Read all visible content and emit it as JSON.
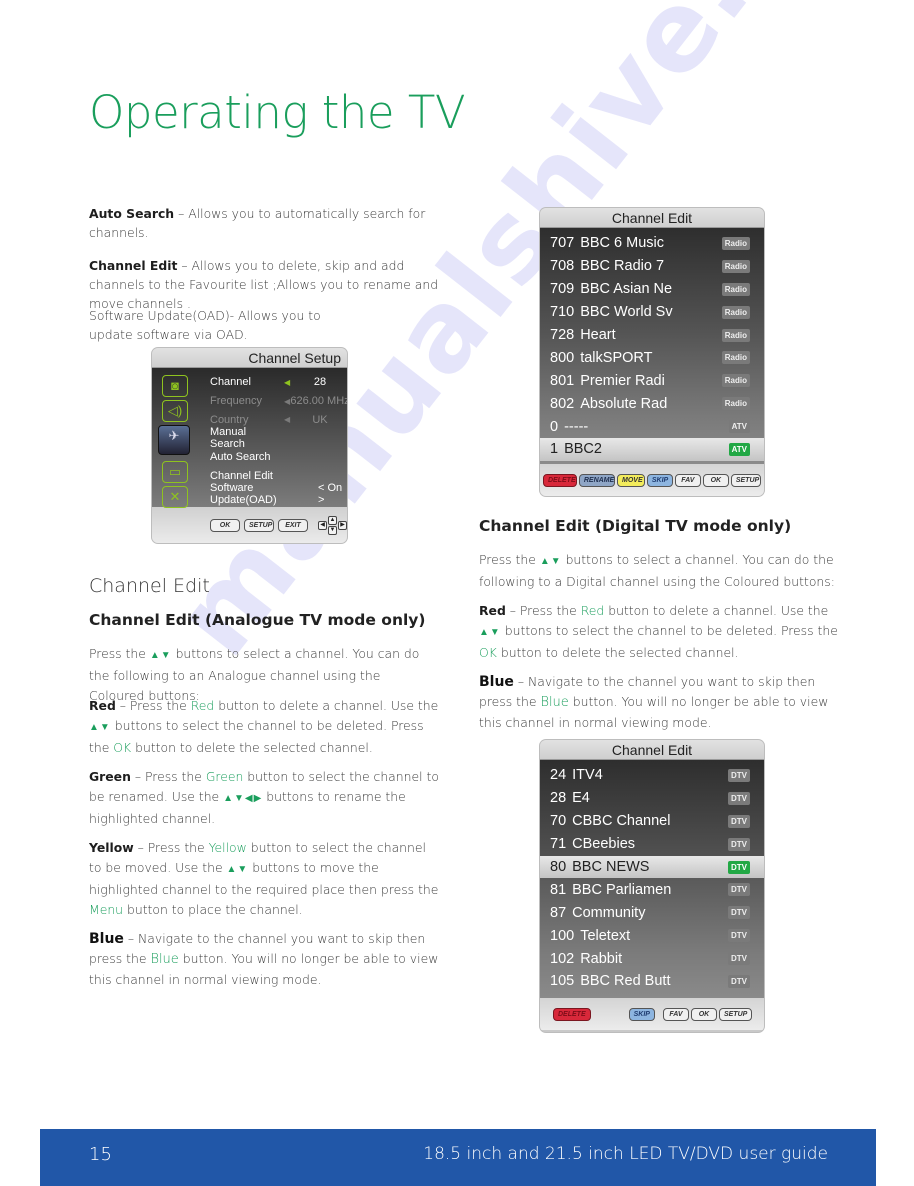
{
  "page": {
    "title": "Operating the TV",
    "watermark": "manualshive.com",
    "colors": {
      "accent_green": "#1a9e5c",
      "footer_blue": "#2157a8",
      "badge_active": "#22a845"
    }
  },
  "intro": {
    "auto_search": {
      "term": "Auto Search",
      "text": " – Allows you to automatically search for channels."
    },
    "channel_edit": {
      "term": "Channel Edit",
      "text": " – Allows you to delete, skip and add channels to the Favourite list ;Allows you to rename and move channels ."
    },
    "software_update": "Software Update(OAD)- Allows you to update software via OAD."
  },
  "channel_setup_menu": {
    "title": "Channel Setup",
    "side_icons": [
      "picture-icon",
      "sound-icon",
      "channel-satellite-icon",
      "screen-icon",
      "tools-icon"
    ],
    "items": [
      {
        "label": "Channel",
        "value": "28",
        "dim": false
      },
      {
        "label": "Frequency",
        "value": "626.00 MHz",
        "dim": true
      },
      {
        "label": "Country",
        "value": "UK",
        "dim": true
      },
      {
        "label": "Manual Search",
        "value": "",
        "dim": false
      },
      {
        "label": "Auto Search",
        "value": "",
        "dim": false
      },
      {
        "label": "Channel Edit",
        "value": "",
        "dim": false
      },
      {
        "label": "Software Update(OAD)",
        "value": "< On >",
        "dim": false
      }
    ],
    "footer_buttons": [
      "OK",
      "SETUP",
      "EXIT"
    ]
  },
  "section": {
    "title": "Channel Edit",
    "analogue": {
      "heading": "Channel Edit (Analogue TV mode only)",
      "intro_a": "Press the ",
      "arrows_ud": "▲▼",
      "intro_b": " buttons to select a channel. You can do the following to an Analogue channel using the Coloured buttons:",
      "red": {
        "term": "Red",
        "a": " – Press the ",
        "key": "Red",
        "b": " button to delete a channel. Use the ",
        "c": " buttons to select the channel to be deleted. Press the ",
        "ok": "OK",
        "d": " button to delete the selected channel."
      },
      "green": {
        "term": "Green",
        "a": " – Press the ",
        "key": "Green",
        "b": " button to select the channel to be renamed. Use the ",
        "arrows": "▲▼◀▶",
        "c": " buttons to rename the highlighted channel."
      },
      "yellow": {
        "term": "Yellow",
        "a": " – Press the ",
        "key": "Yellow",
        "b": " button to select the channel to be moved. Use the ",
        "c": " buttons to move the highlighted channel to the required place then press the ",
        "menu": "Menu",
        "d": " button to place the channel."
      },
      "blue": {
        "term": "Blue",
        "a": " – Navigate to the channel you want to skip then press the ",
        "key": "Blue",
        "b": " button. You will no longer be able to view this channel in normal viewing mode."
      }
    },
    "digital": {
      "heading": "Channel Edit (Digital TV mode only)",
      "intro_a": "Press the ",
      "intro_b": " buttons to select a channel. You can do the following to a Digital channel using the Coloured buttons:",
      "red": {
        "term": "Red",
        "a": " – Press the ",
        "key": "Red",
        "b": " button to delete a channel. Use the ",
        "c": " buttons to select the channel to be deleted. Press the ",
        "ok": "OK",
        "d": " button to delete the selected channel."
      },
      "blue": {
        "term": "Blue",
        "a": " – Navigate to the channel you want to skip then press the ",
        "key": "Blue",
        "b": " button. You will no longer be able to view this channel in normal viewing mode."
      }
    }
  },
  "channel_edit_radio": {
    "title": "Channel Edit",
    "rows": [
      {
        "num": "707",
        "name": "BBC 6 Music",
        "badge": "Radio",
        "selected": false
      },
      {
        "num": "708",
        "name": "BBC Radio 7",
        "badge": "Radio",
        "selected": false
      },
      {
        "num": "709",
        "name": "BBC Asian Ne",
        "badge": "Radio",
        "selected": false
      },
      {
        "num": "710",
        "name": "BBC World Sv",
        "badge": "Radio",
        "selected": false
      },
      {
        "num": "728",
        "name": "Heart",
        "badge": "Radio",
        "selected": false
      },
      {
        "num": "800",
        "name": "talkSPORT",
        "badge": "Radio",
        "selected": false
      },
      {
        "num": "801",
        "name": "Premier Radi",
        "badge": "Radio",
        "selected": false
      },
      {
        "num": "802",
        "name": "Absolute Rad",
        "badge": "Radio",
        "selected": false
      },
      {
        "num": "0",
        "name": "-----",
        "badge": "ATV",
        "selected": false
      },
      {
        "num": "1",
        "name": "BBC2",
        "badge": "ATV",
        "selected": true
      }
    ],
    "buttons": [
      "DELETE",
      "RENAME",
      "MOVE",
      "SKIP",
      "FAV",
      "OK",
      "SETUP"
    ]
  },
  "channel_edit_dtv": {
    "title": "Channel Edit",
    "rows": [
      {
        "num": "24",
        "name": "ITV4",
        "badge": "DTV",
        "selected": false
      },
      {
        "num": "28",
        "name": "E4",
        "badge": "DTV",
        "selected": false
      },
      {
        "num": "70",
        "name": "CBBC Channel",
        "badge": "DTV",
        "selected": false
      },
      {
        "num": "71",
        "name": "CBeebies",
        "badge": "DTV",
        "selected": false
      },
      {
        "num": "80",
        "name": "BBC NEWS",
        "badge": "DTV",
        "selected": true
      },
      {
        "num": "81",
        "name": "BBC Parliamen",
        "badge": "DTV",
        "selected": false
      },
      {
        "num": "87",
        "name": "Community",
        "badge": "DTV",
        "selected": false
      },
      {
        "num": "100",
        "name": "Teletext",
        "badge": "DTV",
        "selected": false
      },
      {
        "num": "102",
        "name": "Rabbit",
        "badge": "DTV",
        "selected": false
      },
      {
        "num": "105",
        "name": "BBC Red Butt",
        "badge": "DTV",
        "selected": false
      }
    ],
    "buttons": [
      "DELETE",
      "SKIP",
      "FAV",
      "OK",
      "SETUP"
    ]
  },
  "footer": {
    "page_number": "15",
    "guide_title": "18.5 inch and 21.5 inch LED TV/DVD user guide"
  }
}
